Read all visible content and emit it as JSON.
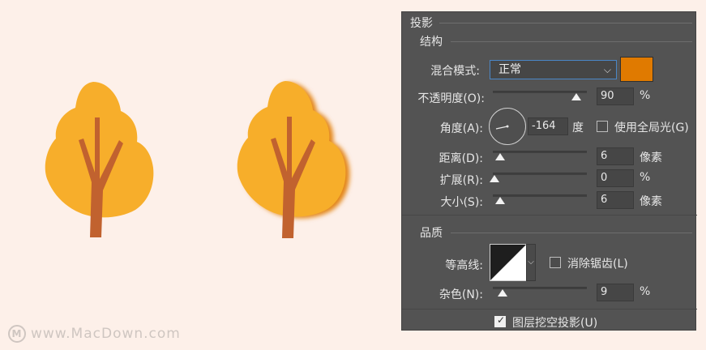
{
  "panel": {
    "title": "投影",
    "structure": {
      "heading": "结构",
      "blend_mode_label": "混合模式:",
      "blend_mode_value": "正常",
      "shadow_color": "#e07a00",
      "opacity_label": "不透明度(O):",
      "opacity_value": "90",
      "opacity_unit": "%",
      "angle_label": "角度(A):",
      "angle_value": "-164",
      "angle_unit": "度",
      "global_light_label": "使用全局光(G)",
      "global_light_checked": false,
      "distance_label": "距离(D):",
      "distance_value": "6",
      "distance_unit": "像素",
      "spread_label": "扩展(R):",
      "spread_value": "0",
      "spread_unit": "%",
      "size_label": "大小(S):",
      "size_value": "6",
      "size_unit": "像素"
    },
    "quality": {
      "heading": "品质",
      "contour_label": "等高线:",
      "anti_alias_label": "消除锯齿(L)",
      "anti_alias_checked": false,
      "noise_label": "杂色(N):",
      "noise_value": "9",
      "noise_unit": "%"
    },
    "knockout_label": "图层挖空投影(U)",
    "knockout_checked": true
  },
  "watermark": {
    "text": "www.MacDown.com",
    "logo_letter": "M"
  },
  "colors": {
    "canvas_bg": "#fdf0e9",
    "panel_bg": "#535353",
    "tree_foliage": "#f7ae2b",
    "tree_trunk": "#c1622f",
    "shadow": "#e07a00"
  },
  "icons": {
    "dropdown": "chevron-down-icon",
    "angle_dial": "angle-dial-icon",
    "contour_curve": "contour-curve-icon",
    "check": "checkmark-icon",
    "tree": "tree-illustration"
  }
}
